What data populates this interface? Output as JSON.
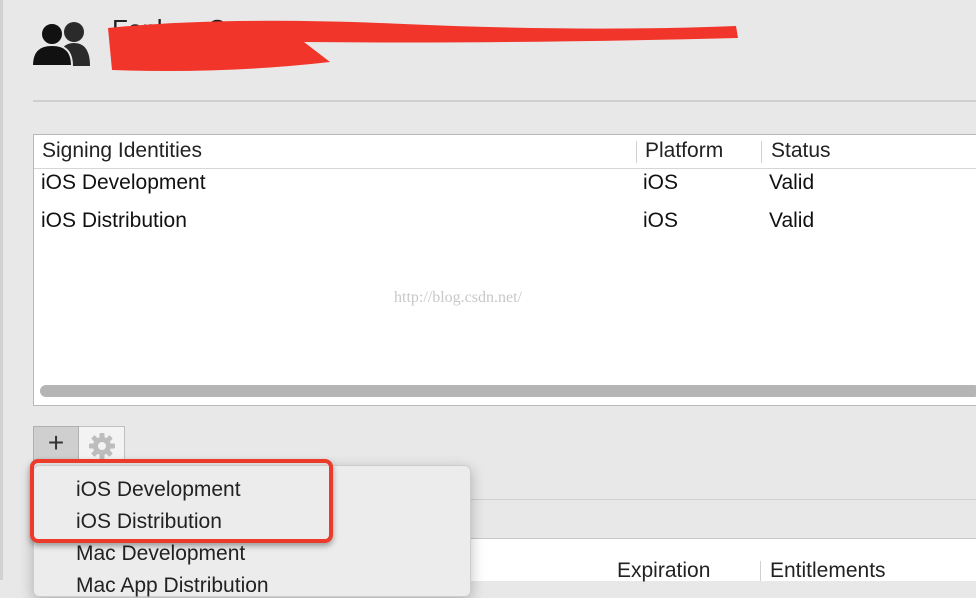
{
  "header": {
    "team_name": "Fenben Co",
    "redaction_color": "#f2352a"
  },
  "signing_table": {
    "columns": [
      "Signing Identities",
      "Platform",
      "Status"
    ],
    "rows": [
      {
        "identity": "iOS Development",
        "platform": "iOS",
        "status": "Valid"
      },
      {
        "identity": "iOS Distribution",
        "platform": "iOS",
        "status": "Valid"
      }
    ],
    "watermark": "http://blog.csdn.net/"
  },
  "toolbar": {
    "add_label": "+",
    "gear_icon": "gear-icon"
  },
  "add_menu": {
    "items": [
      "iOS Development",
      "iOS Distribution",
      "Mac Development",
      "Mac App Distribution"
    ],
    "highlight_color": "#ec3b2b"
  },
  "lower_table": {
    "columns": [
      "Expiration",
      "Entitlements"
    ]
  }
}
